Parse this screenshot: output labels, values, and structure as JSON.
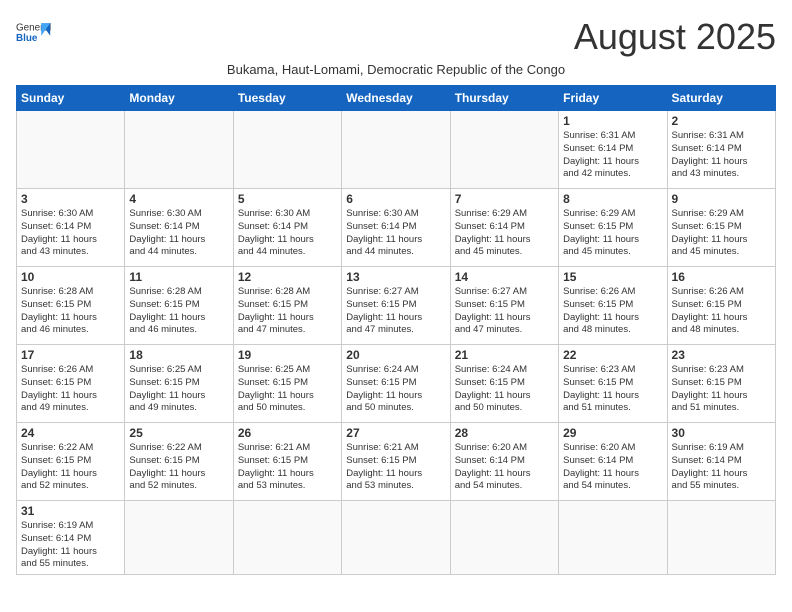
{
  "header": {
    "logo_general": "General",
    "logo_blue": "Blue",
    "month_title": "August 2025",
    "subtitle": "Bukama, Haut-Lomami, Democratic Republic of the Congo"
  },
  "weekdays": [
    "Sunday",
    "Monday",
    "Tuesday",
    "Wednesday",
    "Thursday",
    "Friday",
    "Saturday"
  ],
  "weeks": [
    [
      {
        "day": "",
        "info": ""
      },
      {
        "day": "",
        "info": ""
      },
      {
        "day": "",
        "info": ""
      },
      {
        "day": "",
        "info": ""
      },
      {
        "day": "",
        "info": ""
      },
      {
        "day": "1",
        "info": "Sunrise: 6:31 AM\nSunset: 6:14 PM\nDaylight: 11 hours\nand 42 minutes."
      },
      {
        "day": "2",
        "info": "Sunrise: 6:31 AM\nSunset: 6:14 PM\nDaylight: 11 hours\nand 43 minutes."
      }
    ],
    [
      {
        "day": "3",
        "info": "Sunrise: 6:30 AM\nSunset: 6:14 PM\nDaylight: 11 hours\nand 43 minutes."
      },
      {
        "day": "4",
        "info": "Sunrise: 6:30 AM\nSunset: 6:14 PM\nDaylight: 11 hours\nand 44 minutes."
      },
      {
        "day": "5",
        "info": "Sunrise: 6:30 AM\nSunset: 6:14 PM\nDaylight: 11 hours\nand 44 minutes."
      },
      {
        "day": "6",
        "info": "Sunrise: 6:30 AM\nSunset: 6:14 PM\nDaylight: 11 hours\nand 44 minutes."
      },
      {
        "day": "7",
        "info": "Sunrise: 6:29 AM\nSunset: 6:14 PM\nDaylight: 11 hours\nand 45 minutes."
      },
      {
        "day": "8",
        "info": "Sunrise: 6:29 AM\nSunset: 6:15 PM\nDaylight: 11 hours\nand 45 minutes."
      },
      {
        "day": "9",
        "info": "Sunrise: 6:29 AM\nSunset: 6:15 PM\nDaylight: 11 hours\nand 45 minutes."
      }
    ],
    [
      {
        "day": "10",
        "info": "Sunrise: 6:28 AM\nSunset: 6:15 PM\nDaylight: 11 hours\nand 46 minutes."
      },
      {
        "day": "11",
        "info": "Sunrise: 6:28 AM\nSunset: 6:15 PM\nDaylight: 11 hours\nand 46 minutes."
      },
      {
        "day": "12",
        "info": "Sunrise: 6:28 AM\nSunset: 6:15 PM\nDaylight: 11 hours\nand 47 minutes."
      },
      {
        "day": "13",
        "info": "Sunrise: 6:27 AM\nSunset: 6:15 PM\nDaylight: 11 hours\nand 47 minutes."
      },
      {
        "day": "14",
        "info": "Sunrise: 6:27 AM\nSunset: 6:15 PM\nDaylight: 11 hours\nand 47 minutes."
      },
      {
        "day": "15",
        "info": "Sunrise: 6:26 AM\nSunset: 6:15 PM\nDaylight: 11 hours\nand 48 minutes."
      },
      {
        "day": "16",
        "info": "Sunrise: 6:26 AM\nSunset: 6:15 PM\nDaylight: 11 hours\nand 48 minutes."
      }
    ],
    [
      {
        "day": "17",
        "info": "Sunrise: 6:26 AM\nSunset: 6:15 PM\nDaylight: 11 hours\nand 49 minutes."
      },
      {
        "day": "18",
        "info": "Sunrise: 6:25 AM\nSunset: 6:15 PM\nDaylight: 11 hours\nand 49 minutes."
      },
      {
        "day": "19",
        "info": "Sunrise: 6:25 AM\nSunset: 6:15 PM\nDaylight: 11 hours\nand 50 minutes."
      },
      {
        "day": "20",
        "info": "Sunrise: 6:24 AM\nSunset: 6:15 PM\nDaylight: 11 hours\nand 50 minutes."
      },
      {
        "day": "21",
        "info": "Sunrise: 6:24 AM\nSunset: 6:15 PM\nDaylight: 11 hours\nand 50 minutes."
      },
      {
        "day": "22",
        "info": "Sunrise: 6:23 AM\nSunset: 6:15 PM\nDaylight: 11 hours\nand 51 minutes."
      },
      {
        "day": "23",
        "info": "Sunrise: 6:23 AM\nSunset: 6:15 PM\nDaylight: 11 hours\nand 51 minutes."
      }
    ],
    [
      {
        "day": "24",
        "info": "Sunrise: 6:22 AM\nSunset: 6:15 PM\nDaylight: 11 hours\nand 52 minutes."
      },
      {
        "day": "25",
        "info": "Sunrise: 6:22 AM\nSunset: 6:15 PM\nDaylight: 11 hours\nand 52 minutes."
      },
      {
        "day": "26",
        "info": "Sunrise: 6:21 AM\nSunset: 6:15 PM\nDaylight: 11 hours\nand 53 minutes."
      },
      {
        "day": "27",
        "info": "Sunrise: 6:21 AM\nSunset: 6:15 PM\nDaylight: 11 hours\nand 53 minutes."
      },
      {
        "day": "28",
        "info": "Sunrise: 6:20 AM\nSunset: 6:14 PM\nDaylight: 11 hours\nand 54 minutes."
      },
      {
        "day": "29",
        "info": "Sunrise: 6:20 AM\nSunset: 6:14 PM\nDaylight: 11 hours\nand 54 minutes."
      },
      {
        "day": "30",
        "info": "Sunrise: 6:19 AM\nSunset: 6:14 PM\nDaylight: 11 hours\nand 55 minutes."
      }
    ],
    [
      {
        "day": "31",
        "info": "Sunrise: 6:19 AM\nSunset: 6:14 PM\nDaylight: 11 hours\nand 55 minutes."
      },
      {
        "day": "",
        "info": ""
      },
      {
        "day": "",
        "info": ""
      },
      {
        "day": "",
        "info": ""
      },
      {
        "day": "",
        "info": ""
      },
      {
        "day": "",
        "info": ""
      },
      {
        "day": "",
        "info": ""
      }
    ]
  ]
}
